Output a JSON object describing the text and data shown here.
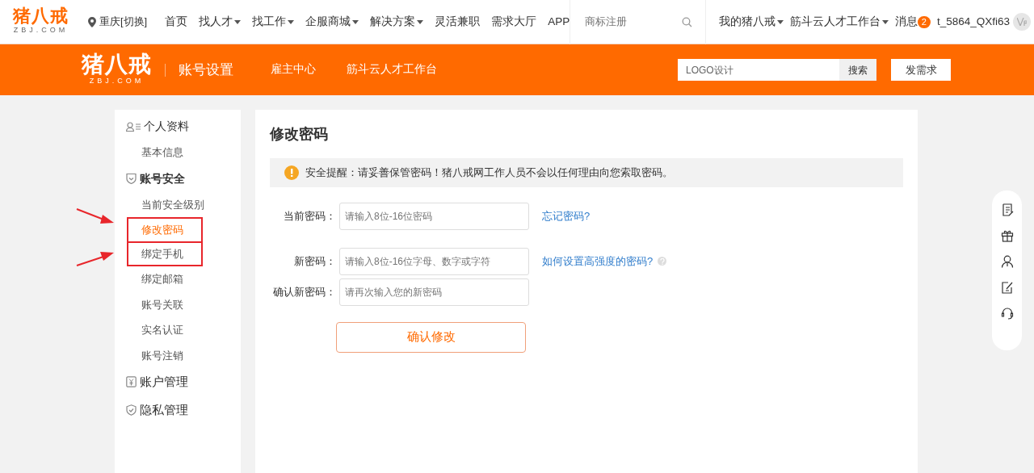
{
  "topbar": {
    "logo": {
      "name": "猪八戒",
      "domain": "ZBJ.COM"
    },
    "city": "重庆[切换]",
    "nav": [
      {
        "label": "首页",
        "dropdown": false
      },
      {
        "label": "找人才",
        "dropdown": true
      },
      {
        "label": "找工作",
        "dropdown": true
      },
      {
        "label": "企服商城",
        "dropdown": true
      },
      {
        "label": "解决方案",
        "dropdown": true
      },
      {
        "label": "灵活兼职",
        "dropdown": false
      },
      {
        "label": "需求大厅",
        "dropdown": false
      },
      {
        "label": "APP",
        "dropdown": false
      }
    ],
    "search": {
      "placeholder": "商标注册"
    },
    "user_menu": [
      {
        "label": "我的猪八戒",
        "dropdown": true
      },
      {
        "label": "筋斗云人才工作台",
        "dropdown": true
      }
    ],
    "messages": {
      "label": "消息",
      "count": "2"
    },
    "username": "t_5864_QXfi63"
  },
  "header": {
    "logo": {
      "name": "猪八戒",
      "domain": "ZBJ.COM"
    },
    "title": "账号设置",
    "links": [
      "雇主中心",
      "筋斗云人才工作台"
    ],
    "search": {
      "value": "LOGO设计",
      "button": "搜索"
    },
    "post_button": "发需求"
  },
  "sidebar": [
    {
      "title": "个人资料",
      "active": false,
      "children": [
        {
          "label": "基本信息",
          "selected": false,
          "annotated": false
        }
      ]
    },
    {
      "title": "账号安全",
      "active": true,
      "children": [
        {
          "label": "当前安全级别",
          "selected": false,
          "annotated": false
        },
        {
          "label": "修改密码",
          "selected": true,
          "annotated": true
        },
        {
          "label": "绑定手机",
          "selected": false,
          "annotated": true
        },
        {
          "label": "绑定邮箱",
          "selected": false,
          "annotated": false
        },
        {
          "label": "账号关联",
          "selected": false,
          "annotated": false
        },
        {
          "label": "实名认证",
          "selected": false,
          "annotated": false
        },
        {
          "label": "账号注销",
          "selected": false,
          "annotated": false
        }
      ]
    },
    {
      "title": "账户管理",
      "active": false
    },
    {
      "title": "隐私管理",
      "active": false
    }
  ],
  "main": {
    "title": "修改密码",
    "notice": "安全提醒：请妥善保管密码！猪八戒网工作人员不会以任何理由向您索取密码。",
    "fields": [
      {
        "label": "当前密码：",
        "placeholder": "请输入8位-16位密码",
        "link": "忘记密码?",
        "help": false
      },
      {
        "label": "新密码：",
        "placeholder": "请输入8位-16位字母、数字或字符",
        "link": "如何设置高强度的密码?",
        "help": true
      },
      {
        "label": "确认新密码：",
        "placeholder": "请再次输入您的新密码",
        "help": false
      }
    ],
    "submit": "确认修改"
  }
}
